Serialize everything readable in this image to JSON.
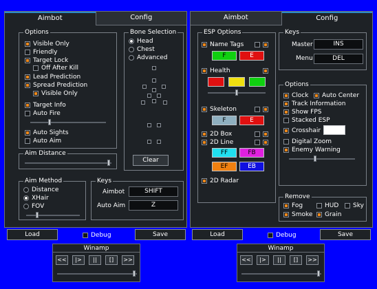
{
  "colors": {
    "background": "#0000ff",
    "panel": "#1e2226",
    "accent": "#2b8bc6",
    "check": "#f08a1c"
  },
  "left": {
    "tabs": [
      "Aimbot",
      "Config"
    ],
    "options_title": "Options",
    "options": [
      {
        "label": "Visible Only",
        "checked": true
      },
      {
        "label": "Friendly",
        "checked": false
      },
      {
        "label": "Target Lock",
        "checked": true
      },
      {
        "label": "Off After Kill",
        "checked": false
      },
      {
        "label": "Lead Prediction",
        "checked": true
      },
      {
        "label": "Spread Prediction",
        "checked": true
      },
      {
        "label": "Visible Only",
        "checked": true
      },
      {
        "label": "Target Info",
        "checked": true
      },
      {
        "label": "Auto Fire",
        "checked": false
      },
      {
        "label": "Auto Sights",
        "checked": true
      },
      {
        "label": "Auto Aim",
        "checked": false
      }
    ],
    "bone_title": "Bone Selection",
    "bones": [
      {
        "label": "Head",
        "selected": true
      },
      {
        "label": "Chest",
        "selected": false
      },
      {
        "label": "Advanced",
        "selected": false
      }
    ],
    "clear_label": "Clear",
    "aim_distance_title": "Aim Distance",
    "aim_distance_level": 0.95,
    "aim_method_title": "Aim Method",
    "aim_methods": [
      {
        "label": "Distance",
        "selected": false
      },
      {
        "label": "XHair",
        "selected": true
      },
      {
        "label": "FOV",
        "selected": false
      }
    ],
    "fov_level": 0.2,
    "keys_title": "Keys",
    "aimbot_key_label": "Aimbot",
    "aimbot_key": "SHIFT",
    "autoaim_key_label": "Auto Aim",
    "autoaim_key": "Z",
    "load_label": "Load",
    "debug_label": "Debug",
    "save_label": "Save"
  },
  "right": {
    "tabs": [
      "Aimbot",
      "Config"
    ],
    "esp_title": "ESP Options",
    "name_tags": "Name Tags",
    "health": "Health",
    "skeleton": "Skeleton",
    "box2d": "2D Box",
    "line2d": "2D Line",
    "radar2d": "2D Radar",
    "swatch_f": "F",
    "swatch_e": "E",
    "swatch_ff": "FF",
    "swatch_fb": "FB",
    "swatch_ef": "EF",
    "swatch_eb": "EB",
    "keys_title": "Keys",
    "master_label": "Master",
    "master_key": "INS",
    "menu_label": "Menu",
    "menu_key": "DEL",
    "options_title": "Options",
    "clock": "Clock",
    "auto_center": "Auto Center",
    "track_info": "Track Information",
    "show_fps": "Show FPS",
    "stacked_esp": "Stacked ESP",
    "crosshair": "Crosshair",
    "digital_zoom": "Digital Zoom",
    "enemy_warning": "Enemy Warning",
    "remove_title": "Remove",
    "fog": "Fog",
    "hud": "HUD",
    "sky": "Sky",
    "smoke": "Smoke",
    "grain": "Grain",
    "load_label": "Load",
    "debug_label": "Debug",
    "save_label": "Save"
  },
  "winamp": {
    "title": "Winamp",
    "buttons": [
      "<<",
      "|>",
      "||",
      "[]",
      ">>"
    ]
  }
}
